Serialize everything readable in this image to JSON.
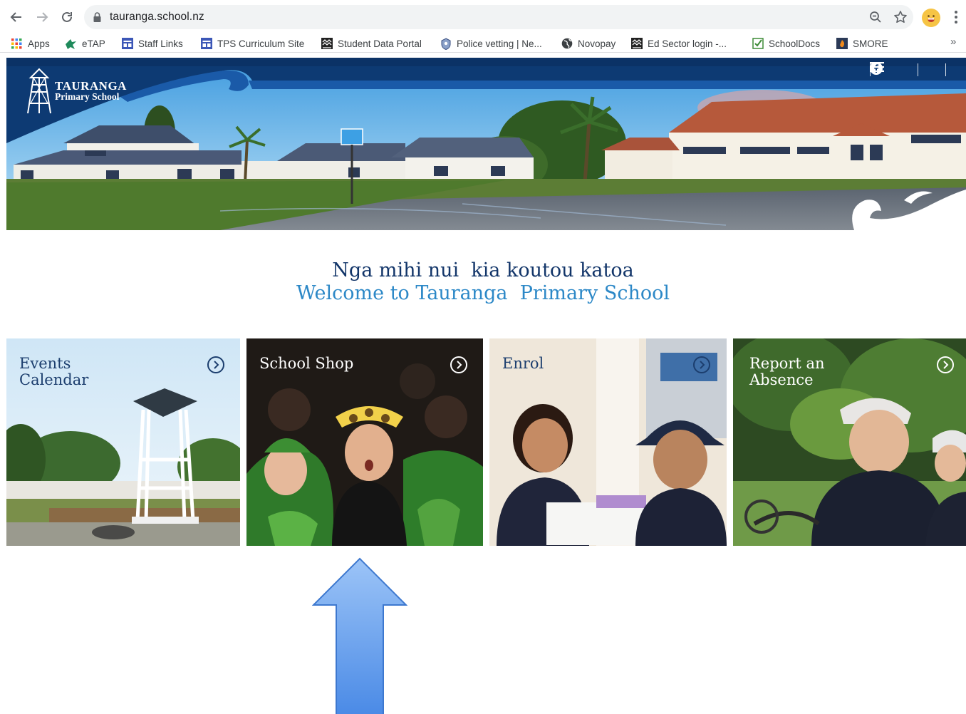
{
  "browser": {
    "url": "tauranga.school.nz",
    "bookmarks": [
      {
        "label": "Apps",
        "icon": "apps-grid-icon"
      },
      {
        "label": "eTAP",
        "icon": "etap-icon"
      },
      {
        "label": "Staff Links",
        "icon": "staff-links-icon"
      },
      {
        "label": "TPS Curriculum Site",
        "icon": "curriculum-site-icon"
      },
      {
        "label": "Student Data Portal",
        "icon": "data-portal-icon"
      },
      {
        "label": "Police vetting | Ne...",
        "icon": "police-badge-icon"
      },
      {
        "label": "Novopay",
        "icon": "globe-icon"
      },
      {
        "label": "Ed Sector login -...",
        "icon": "ed-sector-icon"
      },
      {
        "label": "SchoolDocs",
        "icon": "checkbox-icon"
      },
      {
        "label": "SMORE",
        "icon": "smore-icon"
      }
    ],
    "more_label": "»"
  },
  "site": {
    "logo_line1": "TAURANGA",
    "logo_line2": "Primary School",
    "header_icons": [
      "phone-icon",
      "cart-icon",
      "facebook-icon",
      "menu-icon"
    ],
    "brand_color": "#0d3a73",
    "accent_color": "#2c88c7"
  },
  "welcome": {
    "line1": "Nga mihi nui  kia koutou katoa",
    "line2": "Welcome to Tauranga  Primary School"
  },
  "tiles": [
    {
      "label_line1": "Events",
      "label_line2": "Calendar",
      "icon": "arrow-circle-icon"
    },
    {
      "label_line1": "School Shop",
      "label_line2": "",
      "icon": "arrow-circle-icon"
    },
    {
      "label_line1": "Enrol",
      "label_line2": "",
      "icon": "arrow-circle-icon"
    },
    {
      "label_line1": "Report an",
      "label_line2": "Absence",
      "icon": "arrow-circle-icon"
    }
  ],
  "annotation": {
    "shape": "up-arrow",
    "color": "#6fa8f0",
    "points_to": "School Shop"
  }
}
